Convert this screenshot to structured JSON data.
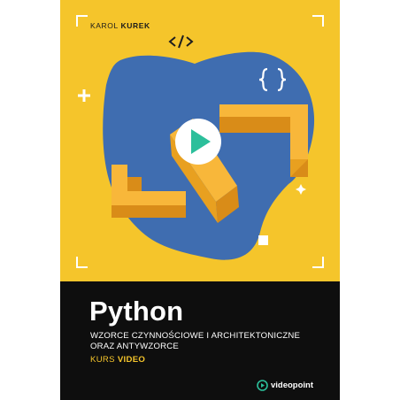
{
  "author": {
    "first_name": "KAROL",
    "last_name": "KUREK"
  },
  "icons": {
    "code_tag": "code-slash-icon",
    "braces": "curly-braces-icon",
    "play": "play-button-icon",
    "corners": "viewfinder-corner-icon"
  },
  "title": "Python",
  "subtitle": "WZORCE CZYNNOŚCIOWE I ARCHITEKTONICZNE ORAZ ANTYWZORCE",
  "course": {
    "prefix": "KURS",
    "type": "VIDEO"
  },
  "publisher": {
    "name": "videopoint"
  },
  "colors": {
    "background": "#f5c52b",
    "blob": "#3f6db0",
    "shape_light": "#f8b73a",
    "shape_dark": "#d98c18",
    "footer": "#0e0e0e",
    "play_accent": "#2cbf9b"
  }
}
